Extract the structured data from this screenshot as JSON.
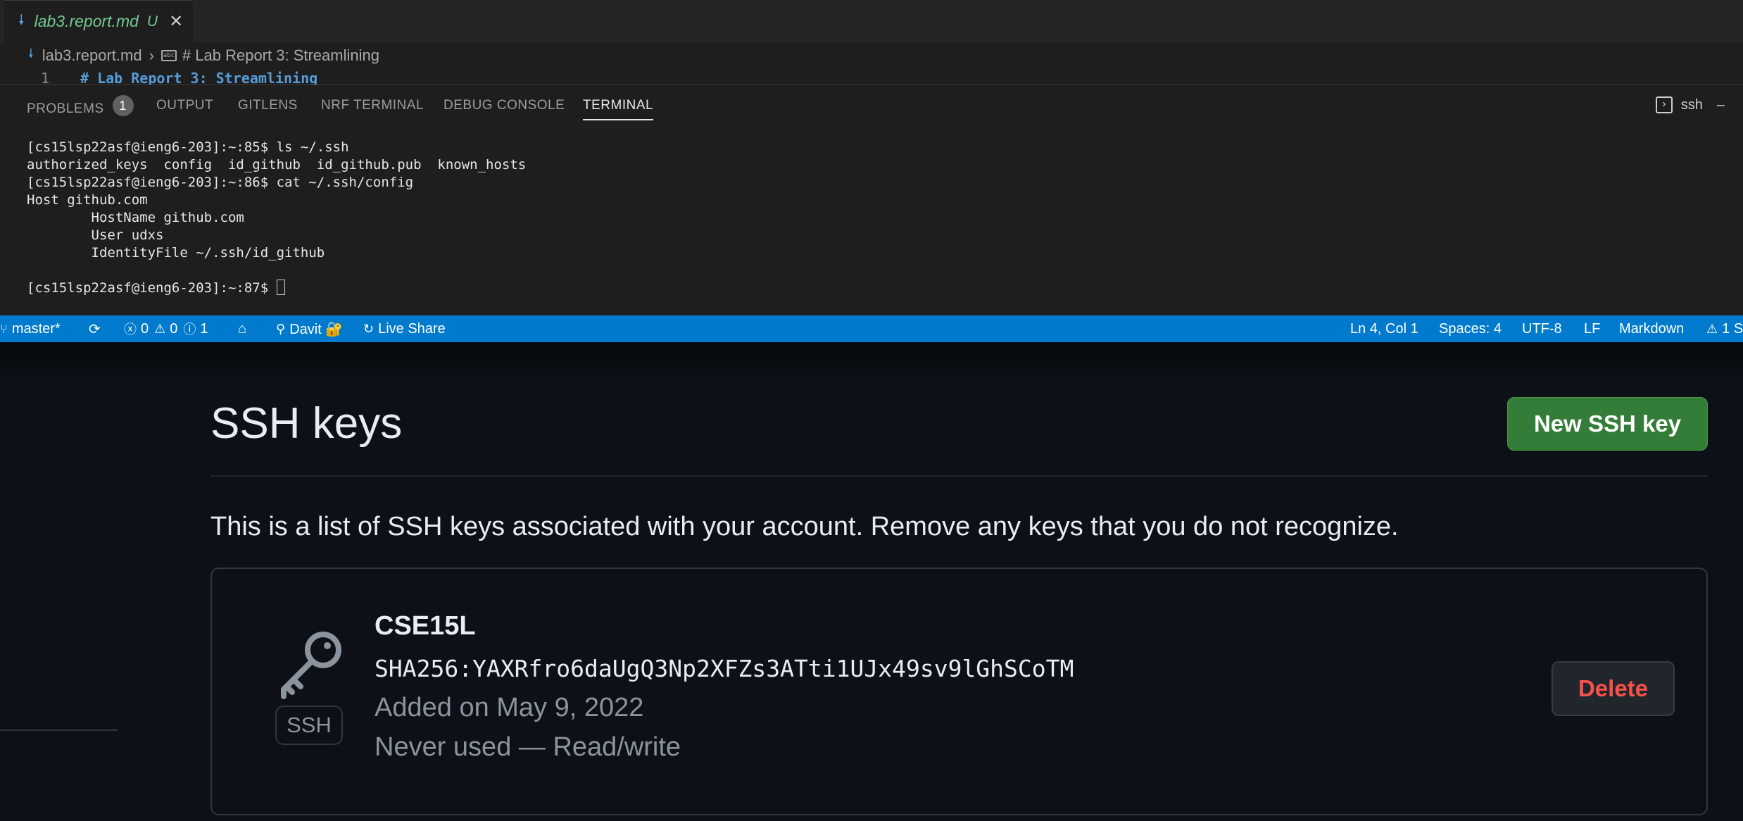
{
  "editor": {
    "tab": {
      "filename": "lab3.report.md",
      "status": "U"
    },
    "breadcrumb": {
      "file": "lab3.report.md",
      "symbol": "# Lab Report 3: Streamlining"
    },
    "line": {
      "number": "1",
      "text": "# Lab Report 3: Streamlining"
    }
  },
  "panel": {
    "tabs": [
      {
        "label": "PROBLEMS",
        "badge": "1"
      },
      {
        "label": "OUTPUT"
      },
      {
        "label": "GITLENS"
      },
      {
        "label": "NRF TERMINAL"
      },
      {
        "label": "DEBUG CONSOLE"
      },
      {
        "label": "TERMINAL",
        "active": true
      }
    ],
    "terminal_name": "ssh",
    "terminal_lines": [
      "[cs15lsp22asf@ieng6-203]:~:85$ ls ~/.ssh",
      "authorized_keys  config  id_github  id_github.pub  known_hosts",
      "[cs15lsp22asf@ieng6-203]:~:86$ cat ~/.ssh/config",
      "Host github.com",
      "        HostName github.com",
      "        User udxs",
      "        IdentityFile ~/.ssh/id_github",
      "",
      "[cs15lsp22asf@ieng6-203]:~:87$ "
    ]
  },
  "statusbar": {
    "branch": "master*",
    "errors": "0",
    "warnings": "0",
    "infos": "1",
    "user": "Davit 🔐",
    "live_share": "Live Share",
    "position": "Ln 4, Col 1",
    "spaces": "Spaces: 4",
    "encoding": "UTF-8",
    "eol": "LF",
    "language": "Markdown",
    "problems_right": "1 S"
  },
  "github": {
    "title": "SSH keys",
    "new_key_button": "New SSH key",
    "description": "This is a list of SSH keys associated with your account. Remove any keys that you do not recognize.",
    "key": {
      "name": "CSE15L",
      "fingerprint": "SHA256:YAXRfro6daUgQ3Np2XFZs3ATti1UJx49sv9lGhSCoTM",
      "added": "Added on May 9, 2022",
      "usage": "Never used — Read/write",
      "type_label": "SSH",
      "delete_button": "Delete"
    }
  },
  "colors": {
    "statusbar": "#007acc",
    "github_bg": "#0d1117",
    "primary_button": "#347d39",
    "danger_text": "#f85149"
  }
}
